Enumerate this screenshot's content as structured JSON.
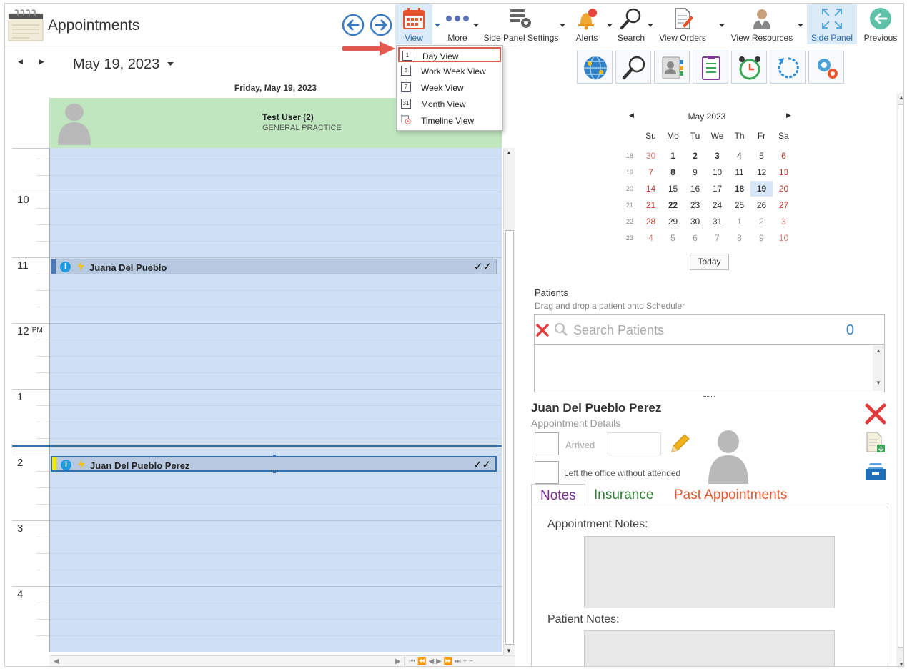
{
  "app": {
    "title": "Appointments"
  },
  "toolbar": {
    "view": "View",
    "more": "More",
    "side_panel_settings": "Side Panel Settings",
    "alerts": "Alerts",
    "search": "Search",
    "view_orders": "View Orders",
    "view_resources": "View Resources",
    "side_panel": "Side Panel",
    "previous": "Previous"
  },
  "view_menu": {
    "items": [
      {
        "icon": "1",
        "label": "Day View"
      },
      {
        "icon": "5",
        "label": "Work Week View"
      },
      {
        "icon": "7",
        "label": "Week View"
      },
      {
        "icon": "31",
        "label": "Month View"
      },
      {
        "icon": "",
        "label": "Timeline View"
      }
    ]
  },
  "scheduler": {
    "date": "May 19, 2023",
    "day_header": "Friday, May 19, 2023",
    "resource_name": "Test User (2)",
    "resource_sub": "GENERAL PRACTICE",
    "hours": [
      {
        "label": "10",
        "ampm": ""
      },
      {
        "label": "11",
        "ampm": ""
      },
      {
        "label": "12",
        "ampm": "PM"
      },
      {
        "label": "1",
        "ampm": ""
      },
      {
        "label": "2",
        "ampm": ""
      },
      {
        "label": "3",
        "ampm": ""
      },
      {
        "label": "4",
        "ampm": ""
      }
    ],
    "appointments": [
      {
        "name": "Juana Del Pueblo",
        "info": "i",
        "checks": "✓✓"
      },
      {
        "name": "Juan Del Pueblo Perez",
        "info": "i",
        "checks": "✓✓"
      }
    ]
  },
  "calendar": {
    "title": "May 2023",
    "dow": [
      "Su",
      "Mo",
      "Tu",
      "We",
      "Th",
      "Fr",
      "Sa"
    ],
    "weeks": [
      "18",
      "19",
      "20",
      "21",
      "22",
      "23"
    ],
    "days": [
      [
        "30",
        "1",
        "2",
        "3",
        "4",
        "5",
        "6"
      ],
      [
        "7",
        "8",
        "9",
        "10",
        "11",
        "12",
        "13"
      ],
      [
        "14",
        "15",
        "16",
        "17",
        "18",
        "19",
        "20"
      ],
      [
        "21",
        "22",
        "23",
        "24",
        "25",
        "26",
        "27"
      ],
      [
        "28",
        "29",
        "30",
        "31",
        "1",
        "2",
        "3"
      ],
      [
        "4",
        "5",
        "6",
        "7",
        "8",
        "9",
        "10"
      ]
    ],
    "today": "Today"
  },
  "patients": {
    "label": "Patients",
    "hint": "Drag and drop a patient onto Scheduler",
    "search_placeholder": "Search Patients",
    "count": "0"
  },
  "details": {
    "patient_name": "Juan Del Pueblo Perez",
    "subtitle": "Appointment Details",
    "arrived": "Arrived",
    "left_office": "Left the office without attended",
    "tabs": [
      "Notes",
      "Insurance",
      "Past Appointments"
    ],
    "appointment_notes": "Appointment Notes:",
    "patient_notes": "Patient Notes:"
  },
  "colors": {
    "accent": "#2e6fb3",
    "resource_bg": "#bfe6bf",
    "grid_bg": "#cfe0f5",
    "tab_notes": "#7b2c8f",
    "tab_insurance": "#2e7d32",
    "tab_past": "#e8552d"
  }
}
